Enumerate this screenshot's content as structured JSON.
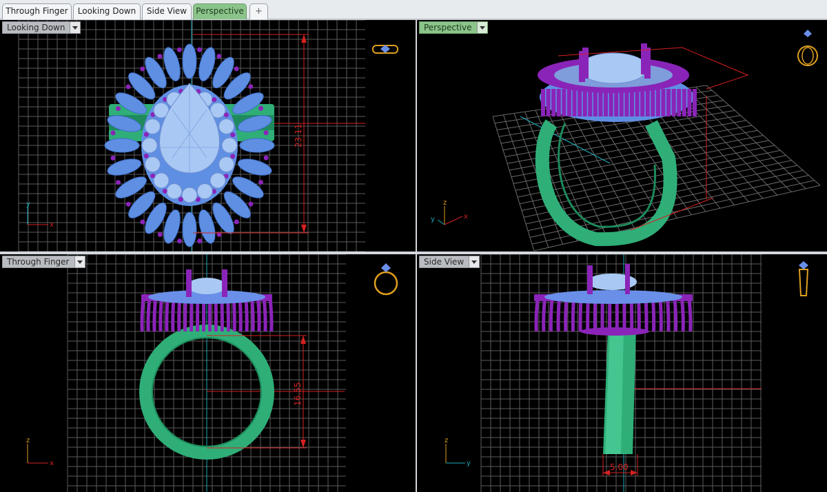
{
  "tabs": [
    {
      "label": "Through Finger",
      "active": false
    },
    {
      "label": "Looking Down",
      "active": false
    },
    {
      "label": "Side View",
      "active": false
    },
    {
      "label": "Perspective",
      "active": true
    }
  ],
  "add_tab_glyph": "+",
  "viewports": {
    "top_left": {
      "label": "Looking Down",
      "dimension": "23.11",
      "axes": [
        "y",
        "x"
      ],
      "icon": "ring-top-view-icon"
    },
    "top_right": {
      "label": "Perspective",
      "axes": [
        "z",
        "y",
        "x"
      ],
      "icon": "ring-perspective-icon"
    },
    "bottom_left": {
      "label": "Through Finger",
      "dimension": "16.55",
      "axes": [
        "z",
        "x"
      ],
      "icon": "ring-front-view-icon"
    },
    "bottom_right": {
      "label": "Side View",
      "dimension": "5.00",
      "axes": [
        "z",
        "y"
      ],
      "icon": "ring-side-view-icon"
    }
  },
  "colors": {
    "viewport_bg": "#000000",
    "grid": "#5c5c5c",
    "band": "#2fae78",
    "prongs": "#8a24b8",
    "petals": "#5f8fe3",
    "gem": "#a9c8f4",
    "dimension": "#d62020",
    "active_tab": "#8bc48a",
    "icon": "#e0a020"
  }
}
